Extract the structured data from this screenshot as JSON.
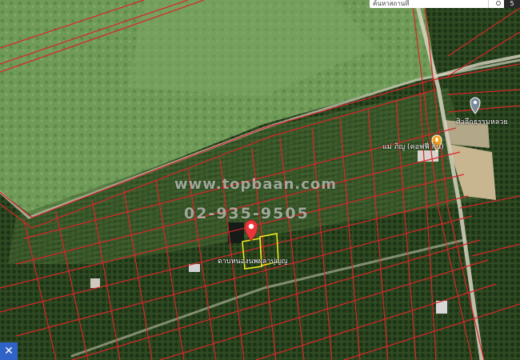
{
  "map": {
    "search": {
      "value": "ค้นหาสถานที่"
    },
    "toolbar_button": "5",
    "close_button": "✕",
    "watermark": {
      "url": "www.topbaan.com",
      "phone": "02-935-9505"
    },
    "labels": {
      "parcel": "ดาบหนองนพผลาปุญญ",
      "cafe": "แม่ ภิญู (คอฟฟี่ กัน)",
      "temple": "ศิวลึกธรรมหลวย"
    },
    "icons": {
      "selected_pin": "location-pin-icon",
      "poi_pin": "map-marker-icon",
      "cafe_marker": "food-icon",
      "search": "search-icon",
      "close": "close-icon"
    },
    "colors": {
      "boundary": "#d8262a",
      "highlight": "#f2ea1e",
      "pin": "#e8373b",
      "cafe_marker": "#f2a11c",
      "close_bg": "#2f63c8"
    }
  }
}
